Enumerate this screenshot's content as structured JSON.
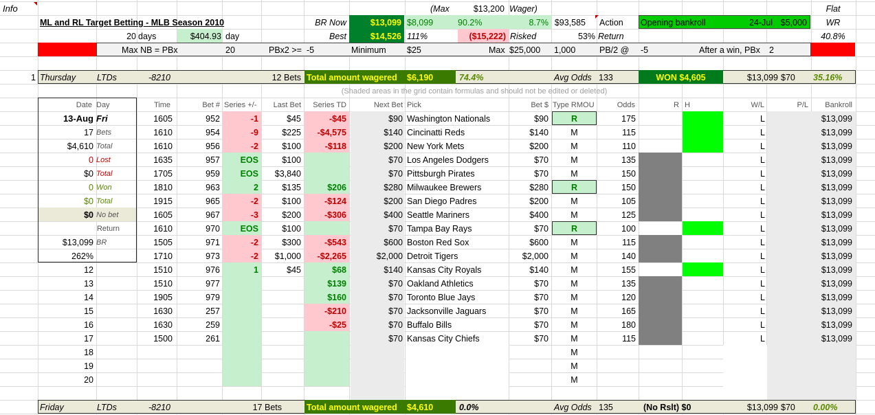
{
  "info": "Info",
  "title": "ML and RL Target Betting - MLB Season 2010",
  "days_n": "20",
  "days_lbl": "days",
  "day_val": "$404.93",
  "day_lbl": "day",
  "brnow_lbl": "BR Now",
  "brnow_val": "$13,099",
  "best_lbl": "Best",
  "best_val": "$14,526",
  "max_lbl": "(Max",
  "max_val": "$13,200",
  "wager_lbl": "Wager)",
  "v8099": "$8,099",
  "p902": "90.2%",
  "p87": "8.7%",
  "v93585": "$93,585",
  "p111": "111%",
  "neg15222": "($15,222)",
  "risked_lbl": "Risked",
  "p53": "53%",
  "return_lbl": "Return",
  "action_lbl": "Action",
  "open_lbl": "Opening bankroll",
  "open_date": "24-Jul",
  "open_val": "$5,000",
  "flat": "Flat",
  "wr": "WR",
  "wr_val": "40.8%",
  "maxnb": "Max NB = PBx",
  "maxnb_v": "20",
  "pbx2": "PBx2 >=",
  "pbx2_v": "-5",
  "min_lbl": "Minimum",
  "min_v": "$25",
  "maxc_lbl": "Max",
  "maxc_v": "$25,000",
  "maxc_n": "1,000",
  "pb2": "PB/2 @",
  "pb2_v": "-5",
  "after": "After a win, PBx",
  "after_v": "2",
  "d1": {
    "num": "1",
    "day": "Thursday",
    "ltds": "LTDs",
    "ltdv": "-8210",
    "bets": "12 Bets",
    "taw": "Total amount wagered",
    "tawv": "$6,190",
    "pct": "74.4%",
    "avg": "Avg Odds",
    "avgv": "133",
    "won": "WON $4,605",
    "br": "$13,099",
    "x70": "$70",
    "ret": "35.16%"
  },
  "d2": {
    "day": "Friday",
    "ltds": "LTDs",
    "ltdv": "-8210",
    "bets": "17 Bets",
    "taw": "Total amount wagered",
    "tawv": "$4,610",
    "pct": "0.0%",
    "avg": "Avg Odds",
    "avgv": "135",
    "won": "(No Rslt) $0",
    "br": "$13,099",
    "x70": "$70",
    "ret": "0.00%"
  },
  "note": "(Shaded areas in the grid contain formulas and should not be edited or deleted)",
  "headers": {
    "date": "Date",
    "day": "Day",
    "time": "Time",
    "betn": "Bet #",
    "series": "Series +/-",
    "last": "Last Bet",
    "std": "Series TD",
    "next": "Next Bet",
    "pick": "Pick",
    "bets": "Bet $",
    "type": "Type RMOU",
    "odds": "Odds",
    "r": "R",
    "h": "H",
    "wl": "W/L",
    "pl": "P/L",
    "bank": "Bankroll"
  },
  "summary": {
    "date": "13-Aug",
    "day": "Fri",
    "bets_n": "17",
    "bets_l": "Bets",
    "total_v": "$4,610",
    "total_l": "Total",
    "lost_n": "0",
    "lost_l": "Lost",
    "lt_v": "$0",
    "lt_l": "Total",
    "won_n": "0",
    "won_l": "Won",
    "wt_v": "$0",
    "wt_l": "Total",
    "nb_v": "$0",
    "nb_l": "No bet",
    "ret_l": "Return",
    "br_v": "$13,099",
    "br_l": "BR",
    "pct": "262%"
  },
  "rows": [
    {
      "n": "",
      "time": "1605",
      "bet": "952",
      "ser": "-1",
      "last": "$45",
      "std": "-$45",
      "next": "$90",
      "pick": "Washington Nationals",
      "bs": "$90",
      "type": "R",
      "odds": "175",
      "wl": "L",
      "bank": "$13,099"
    },
    {
      "n": "",
      "time": "1610",
      "bet": "954",
      "ser": "-9",
      "last": "$225",
      "std": "-$4,575",
      "next": "$140",
      "pick": "Cincinatti Reds",
      "bs": "$140",
      "type": "M",
      "odds": "115",
      "wl": "L",
      "bank": "$13,099"
    },
    {
      "n": "",
      "time": "1610",
      "bet": "956",
      "ser": "-2",
      "last": "$100",
      "std": "-$118",
      "next": "$200",
      "pick": "New York Mets",
      "bs": "$200",
      "type": "M",
      "odds": "110",
      "wl": "L",
      "bank": "$13,099"
    },
    {
      "n": "",
      "time": "1635",
      "bet": "957",
      "ser": "EOS",
      "last": "$100",
      "std": "",
      "next": "$70",
      "pick": "Los Angeles Dodgers",
      "bs": "$70",
      "type": "M",
      "odds": "135",
      "wl": "L",
      "bank": "$13,099"
    },
    {
      "n": "",
      "time": "1705",
      "bet": "959",
      "ser": "EOS",
      "last": "$3,840",
      "std": "",
      "next": "$70",
      "pick": "Pittsburgh Pirates",
      "bs": "$70",
      "type": "M",
      "odds": "150",
      "wl": "L",
      "bank": "$13,099"
    },
    {
      "n": "",
      "time": "1810",
      "bet": "963",
      "ser": "2",
      "last": "$135",
      "std": "$206",
      "next": "$280",
      "pick": "Milwaukee Brewers",
      "bs": "$280",
      "type": "R",
      "odds": "150",
      "wl": "L",
      "bank": "$13,099"
    },
    {
      "n": "",
      "time": "1915",
      "bet": "965",
      "ser": "-2",
      "last": "$100",
      "std": "-$124",
      "next": "$200",
      "pick": "San Diego Padres",
      "bs": "$200",
      "type": "M",
      "odds": "105",
      "wl": "L",
      "bank": "$13,099"
    },
    {
      "n": "",
      "time": "1605",
      "bet": "967",
      "ser": "-3",
      "last": "$200",
      "std": "-$306",
      "next": "$400",
      "pick": "Seattle Mariners",
      "bs": "$400",
      "type": "M",
      "odds": "125",
      "wl": "L",
      "bank": "$13,099"
    },
    {
      "n": "",
      "time": "1610",
      "bet": "970",
      "ser": "EOS",
      "last": "$100",
      "std": "",
      "next": "$70",
      "pick": "Tampa Bay Rays",
      "bs": "$70",
      "type": "R",
      "odds": "100",
      "wl": "L",
      "bank": "$13,099"
    },
    {
      "n": "",
      "time": "1505",
      "bet": "971",
      "ser": "-2",
      "last": "$300",
      "std": "-$543",
      "next": "$600",
      "pick": "Boston Red Sox",
      "bs": "$600",
      "type": "M",
      "odds": "115",
      "wl": "L",
      "bank": "$13,099"
    },
    {
      "n": "",
      "time": "1710",
      "bet": "973",
      "ser": "-2",
      "last": "$1,000",
      "std": "-$2,265",
      "next": "$2,000",
      "pick": "Detroit Tigers",
      "bs": "$2,000",
      "type": "M",
      "odds": "140",
      "wl": "L",
      "bank": "$13,099"
    },
    {
      "n": "12",
      "time": "1510",
      "bet": "976",
      "ser": "1",
      "last": "$45",
      "std": "$68",
      "next": "$140",
      "pick": "Kansas City Royals",
      "bs": "$140",
      "type": "M",
      "odds": "155",
      "wl": "L",
      "bank": "$13,099"
    },
    {
      "n": "13",
      "time": "1510",
      "bet": "977",
      "ser": "",
      "last": "",
      "std": "$139",
      "next": "$70",
      "pick": "Oakland Athletics",
      "bs": "$70",
      "type": "M",
      "odds": "135",
      "wl": "L",
      "bank": "$13,099"
    },
    {
      "n": "14",
      "time": "1905",
      "bet": "979",
      "ser": "",
      "last": "",
      "std": "$160",
      "next": "$70",
      "pick": "Toronto Blue Jays",
      "bs": "$70",
      "type": "M",
      "odds": "120",
      "wl": "L",
      "bank": "$13,099"
    },
    {
      "n": "15",
      "time": "1630",
      "bet": "257",
      "ser": "",
      "last": "",
      "std": "-$210",
      "next": "$70",
      "pick": "Jacksonville Jaguars",
      "bs": "$70",
      "type": "M",
      "odds": "165",
      "wl": "L",
      "bank": "$13,099"
    },
    {
      "n": "16",
      "time": "1630",
      "bet": "259",
      "ser": "",
      "last": "",
      "std": "-$25",
      "next": "$70",
      "pick": "Buffalo Bills",
      "bs": "$70",
      "type": "M",
      "odds": "180",
      "wl": "L",
      "bank": "$13,099"
    },
    {
      "n": "17",
      "time": "1500",
      "bet": "261",
      "ser": "",
      "last": "",
      "std": "",
      "next": "$70",
      "pick": "Kansas City Chiefs",
      "bs": "$70",
      "type": "M",
      "odds": "115",
      "wl": "L",
      "bank": "$13,099"
    },
    {
      "n": "18",
      "time": "",
      "bet": "",
      "ser": "",
      "last": "",
      "std": "",
      "next": "",
      "pick": "",
      "bs": "",
      "type": "M",
      "odds": "",
      "wl": "",
      "bank": ""
    },
    {
      "n": "19",
      "time": "",
      "bet": "",
      "ser": "",
      "last": "",
      "std": "",
      "next": "",
      "pick": "",
      "bs": "",
      "type": "M",
      "odds": "",
      "wl": "",
      "bank": ""
    },
    {
      "n": "20",
      "time": "",
      "bet": "",
      "ser": "",
      "last": "",
      "std": "",
      "next": "",
      "pick": "",
      "bs": "",
      "type": "M",
      "odds": "",
      "wl": "",
      "bank": ""
    }
  ]
}
